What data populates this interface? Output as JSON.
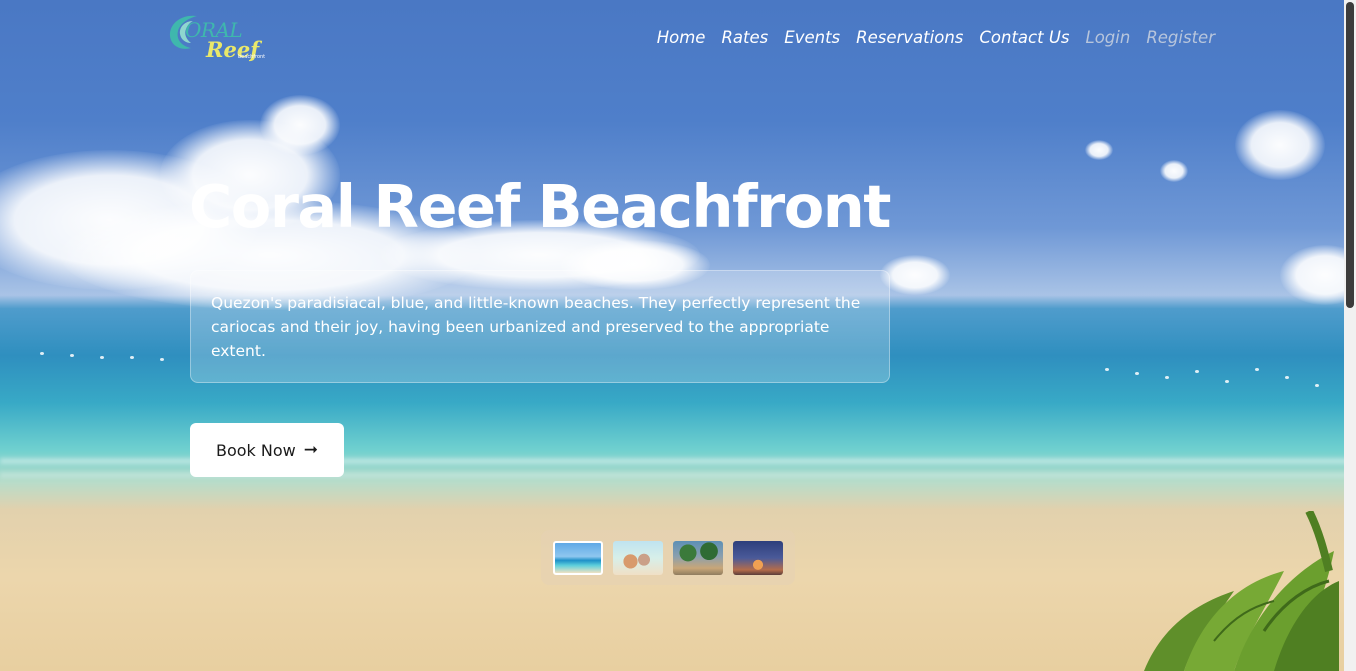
{
  "logo": {
    "text_line1": "ORAL",
    "text_line2": "Reef",
    "text_small": "beachfront",
    "colors": {
      "teal": "#3fb7ad",
      "yellow": "#e9e86a"
    }
  },
  "nav": {
    "items": [
      {
        "label": "Home"
      },
      {
        "label": "Rates"
      },
      {
        "label": "Events"
      },
      {
        "label": "Reservations"
      },
      {
        "label": "Contact Us"
      },
      {
        "label": "Login"
      },
      {
        "label": "Register"
      }
    ]
  },
  "hero": {
    "title": "Coral Reef Beachfront",
    "description": "Quezon's paradisiacal, blue, and little-known beaches. They perfectly represent the cariocas and their joy, having been urbanized and preserved to the appropriate extent.",
    "cta_label": "Book Now",
    "cta_icon": "arrow-right-icon"
  },
  "gallery": {
    "thumbnails": [
      {
        "name": "beach-thumbnail",
        "active": true
      },
      {
        "name": "friends-thumbnail",
        "active": false
      },
      {
        "name": "palm-shore-thumbnail",
        "active": false
      },
      {
        "name": "sunset-thumbnail",
        "active": false
      }
    ]
  },
  "colors": {
    "text_primary": "#ffffff",
    "nav_muted": "#b7c5dc",
    "button_bg": "#ffffff",
    "button_text": "#1b1b1b"
  }
}
